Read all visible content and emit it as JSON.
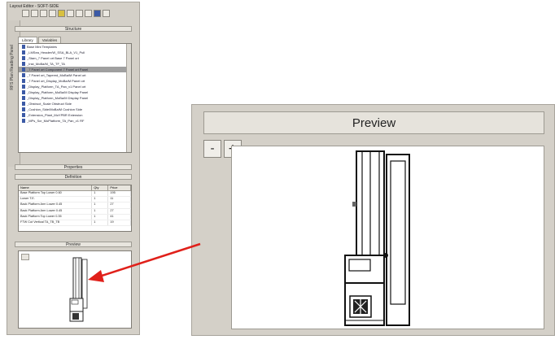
{
  "left_panel": {
    "window_title": "Layout Editor - SOFT-SIDE",
    "side_tab_label": "RFS Plan Reading Panel",
    "sections": {
      "structure": "Structure",
      "properties": "Properties",
      "definition": "Definition",
      "preview": "Preview"
    },
    "tabs": [
      "Library",
      "Variables"
    ],
    "tree_items": [
      "Base Mini Templates",
      "_LMSea_Header/W_SSA_BLA_V1_Pull",
      "_Stam_7 Panel ort Base 7 Panel ort",
      "_Inst_MoBa/M_TA_TF_TA",
      "_7 Panel ort Component 7 Panel ort Panel",
      "_7 Panel ort_Tapered_MoBa/M Panel ort",
      "_7 Panel ort_Display_MoBa/M Panel ort",
      "_Display_Platform_TA_Pan_v1 Panel ort",
      "_Display_Platform_MoBa/M Display Panel",
      "_Display_Platform_MoBa/M Display Panel",
      "_Obstruct_Scale Obstruct Side",
      "_Cushion_Side/MoBa/M Cushion Side",
      "_Extension_Plant_MoYPBR Extension",
      "_MPs_Scr_MoPlatform_TA_Pan_v1 RF"
    ],
    "table": {
      "headers": [
        "Name",
        "Qty",
        "Price"
      ],
      "rows": [
        [
          "Base Platform Top Lower 0.60",
          "1",
          "195"
        ],
        [
          "Lower T.E.",
          "1",
          "11"
        ],
        [
          "Back Platform Arm Lower 0.45",
          "1",
          "27"
        ],
        [
          "Back Platform Arm Lower 0.45",
          "1",
          "27"
        ],
        [
          "Back Platform Top Lower 0.35",
          "1",
          "41"
        ],
        [
          "FTW Cut Vertical TA_TB_TB",
          "1",
          "19"
        ]
      ]
    }
  },
  "preview": {
    "title": "Preview",
    "zoom_out_label": "-",
    "zoom_in_label": "+"
  },
  "colors": {
    "panel_bg": "#d4d0c8",
    "arrow": "#e0201a",
    "selection": "#a0a0a0",
    "accent_icon": "#3c5aa6"
  }
}
